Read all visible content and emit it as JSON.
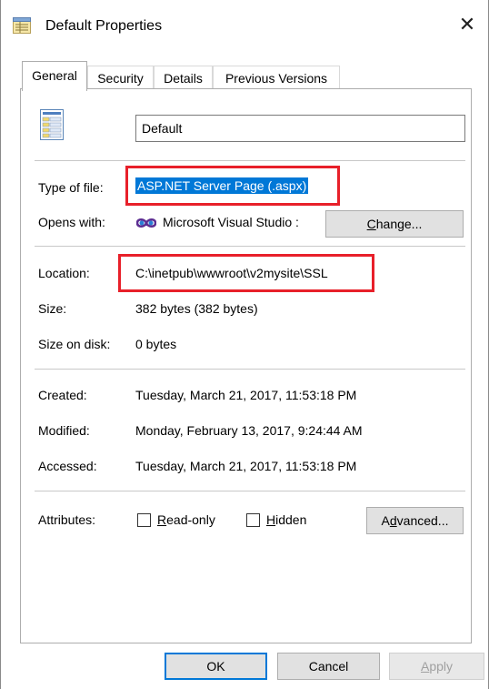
{
  "window": {
    "title": "Default Properties",
    "close_glyph": "✕"
  },
  "tabs": [
    {
      "label": "General",
      "active": true
    },
    {
      "label": "Security",
      "active": false
    },
    {
      "label": "Details",
      "active": false
    },
    {
      "label": "Previous Versions",
      "active": false
    }
  ],
  "general": {
    "file_icon": "aspx-file-icon",
    "name_value": "Default",
    "type_of_file": {
      "label": "Type of file:",
      "value": "ASP.NET Server Page (.aspx)"
    },
    "opens_with": {
      "label": "Opens with:",
      "app_icon": "visual-studio-icon",
      "value": "Microsoft Visual Studio :",
      "change_button": {
        "prefix": "",
        "mnemonic": "C",
        "suffix": "hange..."
      }
    },
    "location": {
      "label": "Location:",
      "value": "C:\\inetpub\\wwwroot\\v2mysite\\SSL"
    },
    "size": {
      "label": "Size:",
      "value": "382 bytes (382 bytes)"
    },
    "size_on_disk": {
      "label": "Size on disk:",
      "value": "0 bytes"
    },
    "created": {
      "label": "Created:",
      "value": "Tuesday, March 21, 2017, 11:53:18 PM"
    },
    "modified": {
      "label": "Modified:",
      "value": "Monday, February 13, 2017, 9:24:44 AM"
    },
    "accessed": {
      "label": "Accessed:",
      "value": "Tuesday, March 21, 2017, 11:53:18 PM"
    },
    "attributes": {
      "label": "Attributes:",
      "read_only": {
        "mnemonic": "R",
        "rest": "ead-only",
        "checked": false
      },
      "hidden": {
        "mnemonic": "H",
        "rest": "idden",
        "checked": false
      },
      "advanced_button": {
        "prefix": "A",
        "mnemonic": "d",
        "suffix": "vanced..."
      }
    }
  },
  "footer": {
    "ok": "OK",
    "cancel": "Cancel",
    "apply_mnemonic": "A",
    "apply_rest": "pply"
  },
  "colors": {
    "highlight_box": "#e8202a",
    "selection": "#0078d7"
  }
}
